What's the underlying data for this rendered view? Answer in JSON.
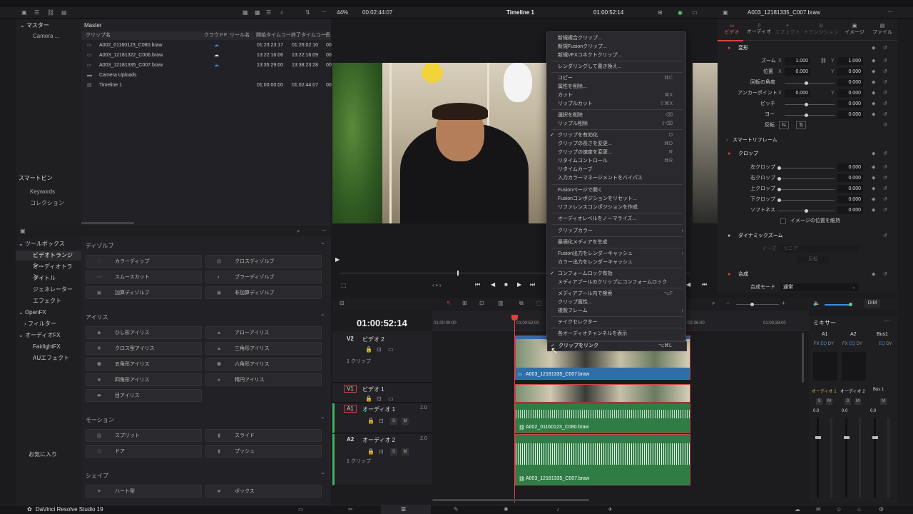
{
  "app": {
    "name": "DaVinci Resolve Studio 19"
  },
  "viewer_bar": {
    "zoom": "44%",
    "duration": "00:02:44:07",
    "timeline_name": "Timeline 1",
    "timecode": "01:00:52:14",
    "clip_name": "A003_12181335_C007.braw"
  },
  "media_pool": {
    "master_label": "マスター",
    "folder": "Camera ...",
    "bin_title": "Master",
    "columns": [
      "クリップ名",
      "クラウドF",
      "リール名",
      "開始タイムコー",
      "終了タイムコー",
      "長"
    ],
    "rows": [
      {
        "name": "A002_01160123_C080.braw",
        "start": "01:23:23:17",
        "end": "01:26:02:10",
        "extra": "00"
      },
      {
        "name": "A003_12181322_C006.braw",
        "start": "13:22:16:06",
        "end": "13:22:16:09",
        "extra": "00"
      },
      {
        "name": "A003_12181335_C007.braw",
        "start": "13:35:29:00",
        "end": "13:38:23:28",
        "extra": "00"
      },
      {
        "name": "Camera Uploads",
        "start": "",
        "end": "",
        "extra": ""
      },
      {
        "name": "Timeline 1",
        "start": "01:00:00:00",
        "end": "01:02:44:07",
        "extra": "00"
      }
    ],
    "smart_bin": "スマートビン",
    "smart_items": [
      "Keywords",
      "コレクション"
    ]
  },
  "effects": {
    "tree": [
      "ツールボックス",
      "ビデオトランジシ...",
      "オーディオトラン...",
      "タイトル",
      "ジェネレーター",
      "エフェクト",
      "OpenFX",
      "フィルター",
      "オーディオFX",
      "FairlightFX",
      "AUエフェクト"
    ],
    "favorites": "お気に入り",
    "sections": {
      "dissolve": "ディゾルブ",
      "iris": "アイリス",
      "motion": "モーション",
      "shape": "シェイプ"
    },
    "dissolve_items": [
      "カラーディップ",
      "クロスディゾルブ",
      "スムースカット",
      "ブラーディゾルブ",
      "加算ディゾルブ",
      "非加算ディゾルブ"
    ],
    "iris_items": [
      "ひし形アイリス",
      "アローアイリス",
      "クロス型アイリス",
      "三角形アイリス",
      "五角形アイリス",
      "六角形アイリス",
      "四角形アイリス",
      "楕円アイリス",
      "目アイリス"
    ],
    "motion_items": [
      "スプリット",
      "スライド",
      "ドア",
      "プッシュ"
    ],
    "shape_items": [
      "ハート型",
      "ボックス"
    ]
  },
  "context_menu": {
    "items": [
      {
        "label": "新規複合クリップ...",
        "shortcut": ""
      },
      {
        "label": "新規Fusionクリップ...",
        "shortcut": ""
      },
      {
        "label": "新規VFXコネクトクリップ...",
        "shortcut": ""
      },
      {
        "label": "レンダリングして置き換え...",
        "shortcut": ""
      },
      {
        "label": "コピー",
        "shortcut": "⌘C"
      },
      {
        "label": "属性を削除...",
        "shortcut": ""
      },
      {
        "label": "カット",
        "shortcut": "⌘X"
      },
      {
        "label": "リップルカット",
        "shortcut": "⇧⌘X"
      },
      {
        "label": "選択を削除",
        "shortcut": "⌫"
      },
      {
        "label": "リップル削除",
        "shortcut": "⇧⌫"
      },
      {
        "label": "クリップを有効化",
        "shortcut": "D"
      },
      {
        "label": "クリップの長さを変更...",
        "shortcut": "⌘D"
      },
      {
        "label": "クリップの速度を変更...",
        "shortcut": "R"
      },
      {
        "label": "リタイムコントロール",
        "shortcut": "⌘R"
      },
      {
        "label": "リタイムカーブ",
        "shortcut": ""
      },
      {
        "label": "入力カラーマネージメントをバイパス",
        "shortcut": ""
      },
      {
        "label": "Fusionページで開く",
        "shortcut": ""
      },
      {
        "label": "Fusionコンポジションをリセット...",
        "shortcut": ""
      },
      {
        "label": "リファレンスコンポジションを作成",
        "shortcut": ""
      },
      {
        "label": "オーディオレベルをノーマライズ...",
        "shortcut": ""
      },
      {
        "label": "クリップカラー",
        "shortcut": ""
      },
      {
        "label": "最適化メディアを生成",
        "shortcut": ""
      },
      {
        "label": "Fusion出力をレンダーキャッシュ",
        "shortcut": ""
      },
      {
        "label": "カラー出力をレンダーキャッシュ",
        "shortcut": ""
      },
      {
        "label": "コンフォームロック有効",
        "shortcut": ""
      },
      {
        "label": "メディアプールのクリップにコンフォームロック",
        "shortcut": ""
      },
      {
        "label": "メディアプール内で検索",
        "shortcut": "⌥F"
      },
      {
        "label": "クリップ属性...",
        "shortcut": ""
      },
      {
        "label": "複製フレーム",
        "shortcut": ""
      },
      {
        "label": "テイクセレクター",
        "shortcut": ""
      },
      {
        "label": "各オーディオチャンネルを表示",
        "shortcut": ""
      },
      {
        "label": "クリップをリンク",
        "shortcut": "⌥⌘L"
      }
    ]
  },
  "inspector": {
    "tabs": [
      "ビデオ",
      "オーディオ",
      "エフェクト",
      "トランジション",
      "イメージ",
      "ファイル"
    ],
    "transform": "変形",
    "zoom_label": "ズーム",
    "zoom_x": "1.000",
    "zoom_y": "1.000",
    "position_label": "位置",
    "pos_x": "0.000",
    "pos_y": "0.000",
    "rotation_label": "回転の角度",
    "rotation": "0.000",
    "anchor_label": "アンカーポイント",
    "anchor_x": "0.000",
    "anchor_y": "0.000",
    "pitch_label": "ピッチ",
    "pitch": "0.000",
    "yaw_label": "ヨー",
    "yaw": "0.000",
    "flip_label": "反転",
    "smart_reframe": "スマートリフレーム",
    "crop": "クロップ",
    "crop_left": "左クロップ",
    "crop_right": "右クロップ",
    "crop_top": "上クロップ",
    "crop_bottom": "下クロップ",
    "softness": "ソフトネス",
    "crop_vals": [
      "0.000",
      "0.000",
      "0.000",
      "0.000",
      "0.000"
    ],
    "retain_image": "イメージの位置を維持",
    "dynamic_zoom": "ダイナミックズーム",
    "ease_label": "イーズ",
    "ease_value": "リニア",
    "swap": "反転",
    "composite": "合成",
    "composite_mode_label": "合成モード",
    "composite_mode": "通常"
  },
  "timeline": {
    "timecode": "01:00:52:14",
    "ruler": [
      "01:00:00:00",
      "01:00:52:00",
      "01:02:36:00",
      "01:03:28:00"
    ],
    "tracks": [
      {
        "id": "V2",
        "name": "ビデオ 2",
        "clips": "1 クリップ"
      },
      {
        "id": "V1",
        "name": "ビデオ 1",
        "clips": ""
      },
      {
        "id": "A1",
        "name": "オーディオ 1",
        "level": "2.0",
        "clips": ""
      },
      {
        "id": "A2",
        "name": "オーディオ 2",
        "level": "2.0",
        "clips": "1 クリップ"
      }
    ],
    "clip_v": "A003_12181335_C007.braw",
    "clip_a1": "A002_01160123_C080.braw",
    "clip_a2": "A003_12181335_C007.braw"
  },
  "mixer": {
    "title": "ミキサー",
    "channels": [
      "A1",
      "A2",
      "Bus1"
    ],
    "channel_names": [
      "オーディオ 1",
      "オーディオ 2",
      "Bus 1"
    ],
    "dim": "DIM",
    "levels": [
      "0.0",
      "0.0",
      "0.0"
    ]
  },
  "colors": {
    "accent": "#e0403c",
    "audio_clip": "#2f7d45",
    "video_clip": "#2f6fa8"
  }
}
